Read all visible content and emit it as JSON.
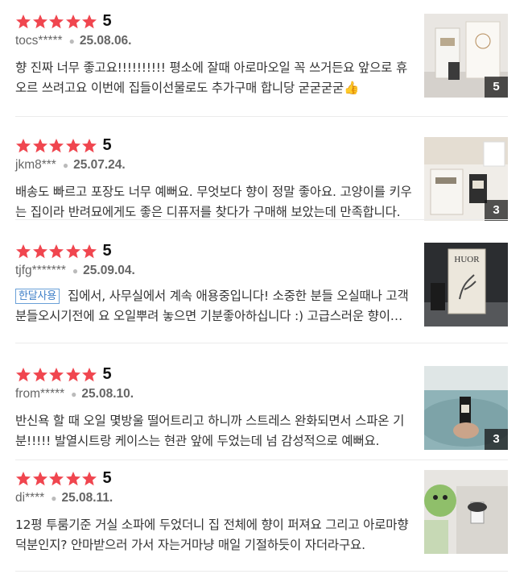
{
  "reviews": [
    {
      "rating": "5",
      "user": "tocs*****",
      "date": "25.08.06.",
      "badge": "",
      "text": "향 진짜 너무 좋고요!!!!!!!!!! 평소에 잘때 아로마오일 꼭 쓰거든요 앞으로 휴오르 쓰려고요 이번에 집들이선물로도 추가구매 합니당 굳굳굳굳👍",
      "photo_count": "5"
    },
    {
      "rating": "5",
      "user": "jkm8***",
      "date": "25.07.24.",
      "badge": "",
      "text": "배송도 빠르고 포장도 너무 예뻐요. 무엇보다 향이 정말 좋아요. 고양이를 키우는 집이라 반려묘에게도 좋은 디퓨저를 찾다가 구매해 보았는데 만족합니다.",
      "photo_count": "3"
    },
    {
      "rating": "5",
      "user": "tjfg*******",
      "date": "25.09.04.",
      "badge": "한달사용",
      "text": "집에서, 사무실에서 계속 애용중입니다! 소중한 분들 오실때나 고객분들오시기전에 요 오일뿌려 놓으면 기분좋아하십니다 :) 고급스러운 향이에요.",
      "photo_count": ""
    },
    {
      "rating": "5",
      "user": "from*****",
      "date": "25.08.10.",
      "badge": "",
      "text": "반신욕 할 때 오일 몇방울 떨어트리고 하니까 스트레스 완화되면서 스파온 기분!!!!! 발열시트랑 케이스는 현관 앞에 두었는데 넘 감성적으로 예뻐요.",
      "photo_count": "3"
    },
    {
      "rating": "5",
      "user": "di****",
      "date": "25.08.11.",
      "badge": "",
      "text": "12평 투룸기준 거실 소파에 두었더니 집 전체에 향이 퍼져요 그리고 아로마향 덕분인지? 안마받으러 가서 자는거마냥 매일 기절하듯이 자더라구요.",
      "photo_count": ""
    }
  ],
  "thumb_product_label": "HUOR"
}
